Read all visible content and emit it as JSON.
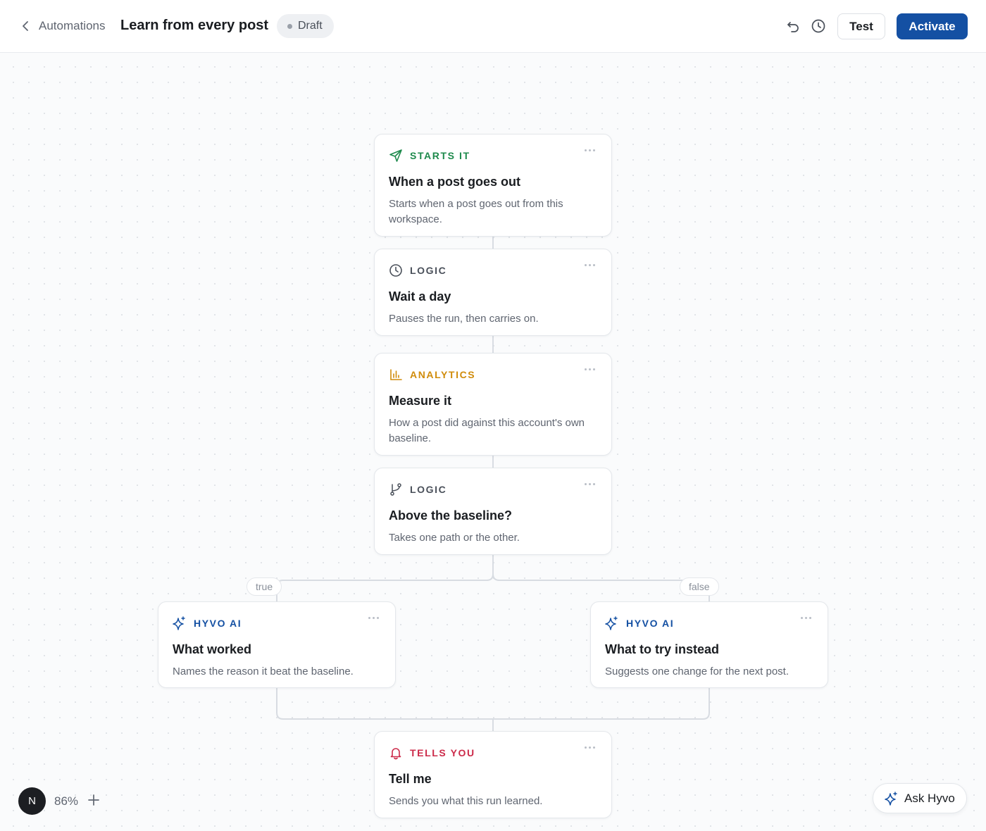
{
  "header": {
    "breadcrumb": "Automations",
    "title": "Learn from every post",
    "status": "Draft",
    "test_label": "Test",
    "activate_label": "Activate"
  },
  "nodes": [
    {
      "kicker": "STARTS IT",
      "kicker_color": "#1e8a4c",
      "icon": "send-icon",
      "title": "When a post goes out",
      "desc": "Starts when a post goes out from this workspace."
    },
    {
      "kicker": "LOGIC",
      "kicker_color": "#4a505a",
      "icon": "clock-icon",
      "title": "Wait a day",
      "desc": "Pauses the run, then carries on."
    },
    {
      "kicker": "ANALYTICS",
      "kicker_color": "#d08c0b",
      "icon": "bar-chart-icon",
      "title": "Measure it",
      "desc": "How a post did against this account's own baseline."
    },
    {
      "kicker": "LOGIC",
      "kicker_color": "#4a505a",
      "icon": "branch-icon",
      "title": "Above the baseline?",
      "desc": "Takes one path or the other."
    },
    {
      "kicker": "HYVO AI",
      "kicker_color": "#1450a3",
      "icon": "sparkle-icon",
      "title": "What worked",
      "desc": "Names the reason it beat the baseline."
    },
    {
      "kicker": "HYVO AI",
      "kicker_color": "#1450a3",
      "icon": "sparkle-icon",
      "title": "What to try instead",
      "desc": "Suggests one change for the next post."
    },
    {
      "kicker": "TELLS YOU",
      "kicker_color": "#cc2b4a",
      "icon": "bell-icon",
      "title": "Tell me",
      "desc": "Sends you what this run learned."
    }
  ],
  "branches": {
    "true_label": "true",
    "false_label": "false"
  },
  "footer": {
    "avatar_initial": "N",
    "zoom": "86%",
    "ask_label": "Ask Hyvo"
  }
}
